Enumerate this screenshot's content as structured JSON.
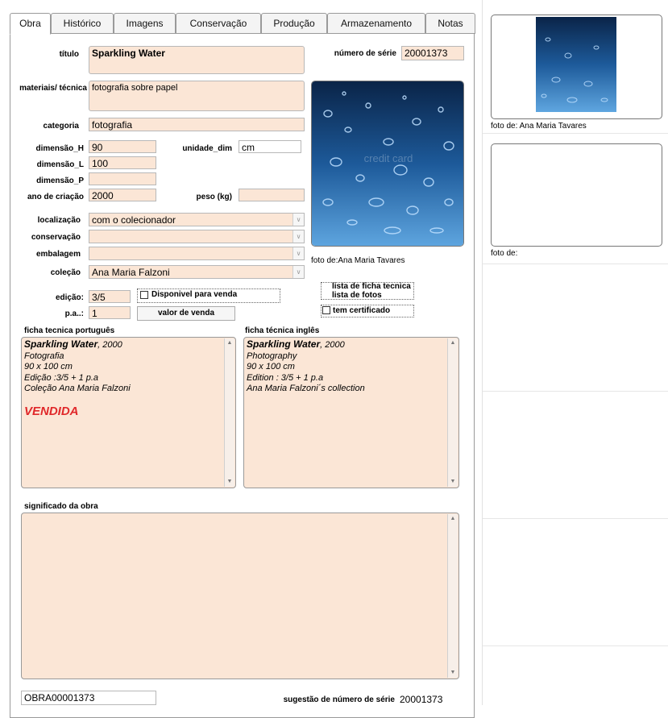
{
  "tabs": [
    "Obra",
    "Histórico",
    "Imagens",
    "Conservação",
    "Produção",
    "Armazenamento",
    "Notas"
  ],
  "form": {
    "titulo_label": "título",
    "titulo": "Sparkling Water",
    "numero_serie_label": "número de série",
    "numero_serie": "20001373",
    "materiais_label": "materiais/ técnica",
    "materiais": "fotografia sobre papel",
    "categoria_label": "categoria",
    "categoria": "fotografia",
    "dim_h_label": "dimensão_H",
    "dim_h": "90",
    "unidade_label": "unidade_dim",
    "unidade": "cm",
    "dim_l_label": "dimensão_L",
    "dim_l": "100",
    "dim_p_label": "dimensão_P",
    "dim_p": "",
    "ano_label": "ano de criação",
    "ano": "2000",
    "peso_label": "peso (kg)",
    "peso": "",
    "localizacao_label": "localização",
    "localizacao": "com o colecionador",
    "conservacao_label": "conservação",
    "conservacao": "",
    "embalagem_label": "embalagem",
    "embalagem": "",
    "colecao_label": "coleção",
    "colecao": "Ana Maria Falzoni",
    "foto_caption": "foto de:Ana Maria Tavares",
    "edicao_label": "edição:",
    "edicao": "3/5",
    "pa_label": "p.a..:",
    "pa": "1",
    "disponivel_label": "Disponivel para venda",
    "valor_venda_button": "valor de venda",
    "lista_ficha_label": "lista de ficha tecnica",
    "lista_fotos_label": "lista de fotos",
    "tem_certificado_label": "tem certificado",
    "ficha_pt_label": "ficha tecnica português",
    "ficha_en_label": "ficha técnica inglês",
    "significado_label": "significado da obra",
    "significado": "",
    "obra_id": "OBRA00001373",
    "sugestao_label": "sugestão de número de série",
    "sugestao": "20001373"
  },
  "ficha_pt": {
    "title": "Sparkling Water",
    "year": ", 2000",
    "lines": [
      "Fotografia",
      "90 x 100 cm",
      "Edição :3/5 + 1 p.a",
      "Coleção Ana Maria Falzoni"
    ],
    "status": "VENDIDA"
  },
  "ficha_en": {
    "title": "Sparkling Water",
    "year": ", 2000",
    "lines": [
      "Photography",
      "90 x 100 cm",
      "Edition : 3/5 + 1 p.a",
      "Ana Maria Falzoni´s collection"
    ]
  },
  "photo_watermark": "credit card",
  "sidebar": {
    "captions": [
      "foto de: Ana Maria Tavares",
      "foto de:"
    ]
  },
  "colors": {
    "field_bg": "#fbe6d6",
    "sold_red": "#e0282a",
    "water_dark": "#0e2f5c",
    "water_light": "#4a8fd0"
  }
}
